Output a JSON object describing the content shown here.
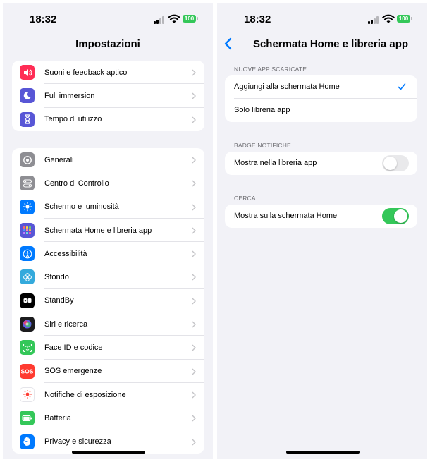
{
  "status_bar": {
    "time": "18:32",
    "battery": "100"
  },
  "left_screen": {
    "title": "Impostazioni",
    "group1": [
      {
        "label": "Suoni e feedback aptico",
        "icon": "speaker-icon",
        "color": "#ff2d55"
      },
      {
        "label": "Full immersion",
        "icon": "moon-icon",
        "color": "#5856d6"
      },
      {
        "label": "Tempo di utilizzo",
        "icon": "hourglass-icon",
        "color": "#5856d6"
      }
    ],
    "group2": [
      {
        "label": "Generali",
        "icon": "gear-icon",
        "color": "#8e8e93"
      },
      {
        "label": "Centro di Controllo",
        "icon": "toggles-icon",
        "color": "#8e8e93"
      },
      {
        "label": "Schermo e luminosità",
        "icon": "sun-icon",
        "color": "#007aff"
      },
      {
        "label": "Schermata Home e libreria app",
        "icon": "app-grid-icon",
        "color": "#5856d6"
      },
      {
        "label": "Accessibilità",
        "icon": "accessibility-icon",
        "color": "#007aff"
      },
      {
        "label": "Sfondo",
        "icon": "flower-icon",
        "color": "#34aadc"
      },
      {
        "label": "StandBy",
        "icon": "standby-icon",
        "color": "#000000"
      },
      {
        "label": "Siri e ricerca",
        "icon": "siri-icon",
        "color": "#1c1c1e"
      },
      {
        "label": "Face ID e codice",
        "icon": "face-id-icon",
        "color": "#34c759"
      },
      {
        "label": "SOS emergenze",
        "icon": "sos-icon",
        "color": "#ff3b30"
      },
      {
        "label": "Notifiche di esposizione",
        "icon": "exposure-icon",
        "color": "#ffffff"
      },
      {
        "label": "Batteria",
        "icon": "battery-icon",
        "color": "#34c759"
      },
      {
        "label": "Privacy e sicurezza",
        "icon": "hand-icon",
        "color": "#007aff"
      }
    ]
  },
  "right_screen": {
    "title": "Schermata Home e libreria app",
    "sections": [
      {
        "header": "NUOVE APP SCARICATE",
        "options": [
          {
            "label": "Aggiungi alla schermata Home",
            "selected": true
          },
          {
            "label": "Solo libreria app",
            "selected": false
          }
        ]
      },
      {
        "header": "BADGE NOTIFICHE",
        "toggle_label": "Mostra nella libreria app",
        "toggle_on": false
      },
      {
        "header": "CERCA",
        "toggle_label": "Mostra sulla schermata Home",
        "toggle_on": true
      }
    ]
  }
}
